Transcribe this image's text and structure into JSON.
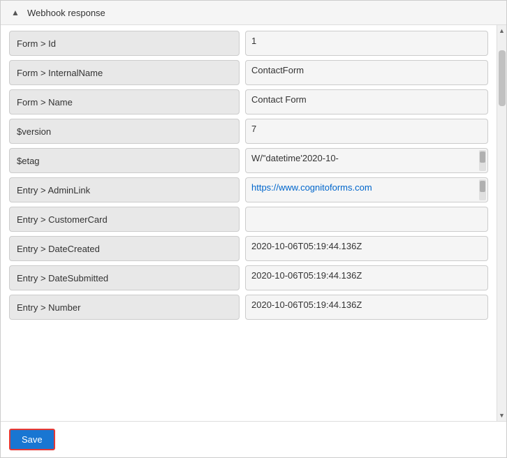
{
  "header": {
    "title": "Webhook response",
    "collapse_icon": "▲"
  },
  "fields": [
    {
      "label": "Form > Id",
      "value": "1",
      "has_scrollbar": false,
      "is_link": false
    },
    {
      "label": "Form > InternalName",
      "value": "ContactForm",
      "has_scrollbar": false,
      "is_link": false
    },
    {
      "label": "Form > Name",
      "value": "Contact Form",
      "has_scrollbar": false,
      "is_link": false
    },
    {
      "label": "$version",
      "value": "7",
      "has_scrollbar": false,
      "is_link": false
    },
    {
      "label": "$etag",
      "value": "W/\"datetime'2020-10-",
      "has_scrollbar": true,
      "is_link": false
    },
    {
      "label": "Entry > AdminLink",
      "value": "https://www.cognitoforms.com",
      "has_scrollbar": true,
      "is_link": true
    },
    {
      "label": "Entry > CustomerCard",
      "value": "",
      "has_scrollbar": false,
      "is_link": false
    },
    {
      "label": "Entry > DateCreated",
      "value": "2020-10-06T05:19:44.136Z",
      "has_scrollbar": false,
      "is_link": false
    },
    {
      "label": "Entry > DateSubmitted",
      "value": "2020-10-06T05:19:44.136Z",
      "has_scrollbar": false,
      "is_link": false
    },
    {
      "label": "Entry > Number",
      "value": "2020-10-06T05:19:44.136Z",
      "has_scrollbar": false,
      "is_link": false
    }
  ],
  "footer": {
    "save_label": "Save"
  }
}
